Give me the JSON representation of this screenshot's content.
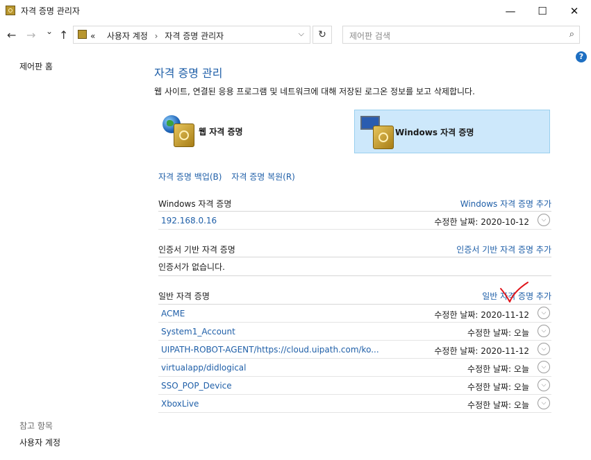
{
  "window": {
    "title": "자격 증명 관리자",
    "minimize": "—",
    "maximize": "☐",
    "close": "✕"
  },
  "toolbar": {
    "back": "←",
    "forward": "→",
    "recent": "⌄",
    "up": "↑",
    "breadcrumb_prefix": "«",
    "breadcrumb": [
      "사용자 계정",
      "자격 증명 관리자"
    ],
    "breadcrumb_sep": "›",
    "dropdown": "⌵",
    "refresh": "↻",
    "search_placeholder": "제어판 검색",
    "search_icon": "⌕"
  },
  "help": "?",
  "sidebar": {
    "home": "제어판 홈",
    "see_also": "참고 항목",
    "user_accounts": "사용자 계정"
  },
  "main": {
    "heading": "자격 증명 관리",
    "description": "웹 사이트, 연결된 응용 프로그램 및 네트워크에 대해 저장된 로그온 정보를 보고 삭제합니다.",
    "tiles": [
      {
        "label": "웹 자격 증명",
        "icon": "globe-safe-icon",
        "selected": false
      },
      {
        "label": "Windows 자격 증명",
        "icon": "monitor-safe-icon",
        "selected": true
      }
    ],
    "backup": "자격 증명 백업(B)",
    "restore": "자격 증명 복원(R)",
    "windows_section": {
      "title": "Windows 자격 증명",
      "add": "Windows 자격 증명 추가",
      "items": [
        {
          "name": "192.168.0.16",
          "modified": "수정한 날짜:  2020-10-12"
        }
      ]
    },
    "cert_section": {
      "title": "인증서 기반 자격 증명",
      "add": "인증서 기반 자격 증명 추가",
      "empty": "인증서가 없습니다."
    },
    "generic_section": {
      "title": "일반 자격 증명",
      "add": "일반 자격 증명 추가",
      "items": [
        {
          "name": "ACME",
          "modified": "수정한 날짜:  2020-11-12"
        },
        {
          "name": "System1_Account",
          "modified": "수정한 날짜:  오늘"
        },
        {
          "name": "UIPATH-ROBOT-AGENT/https://cloud.uipath.com/ko...",
          "modified": "수정한 날짜:  2020-11-12"
        },
        {
          "name": "virtualapp/didlogical",
          "modified": "수정한 날짜:  오늘"
        },
        {
          "name": "SSO_POP_Device",
          "modified": "수정한 날짜:  오늘"
        },
        {
          "name": "XboxLive",
          "modified": "수정한 날짜:  오늘"
        }
      ]
    },
    "expand_icon": "⌵",
    "annotation_color": "#e0151b"
  }
}
